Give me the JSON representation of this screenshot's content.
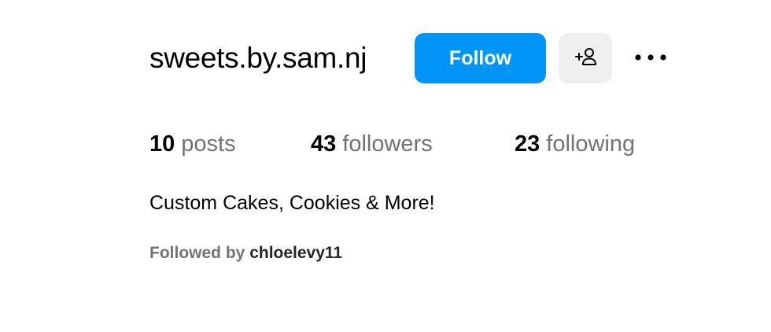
{
  "profile": {
    "username": "sweets.by.sam.nj",
    "follow_label": "Follow",
    "suggest_icon": "add-person-icon",
    "more_icon": "more-horizontal-icon",
    "bio": "Custom Cakes, Cookies & More!"
  },
  "stats": {
    "posts": {
      "count": "10",
      "label": "posts"
    },
    "followers": {
      "count": "43",
      "label": "followers"
    },
    "following": {
      "count": "23",
      "label": "following"
    }
  },
  "followed_by": {
    "prefix": "Followed by",
    "users": "chloelevy11"
  },
  "colors": {
    "accent": "#0095f6",
    "secondary_button": "#efefef",
    "muted_text": "#737373"
  }
}
